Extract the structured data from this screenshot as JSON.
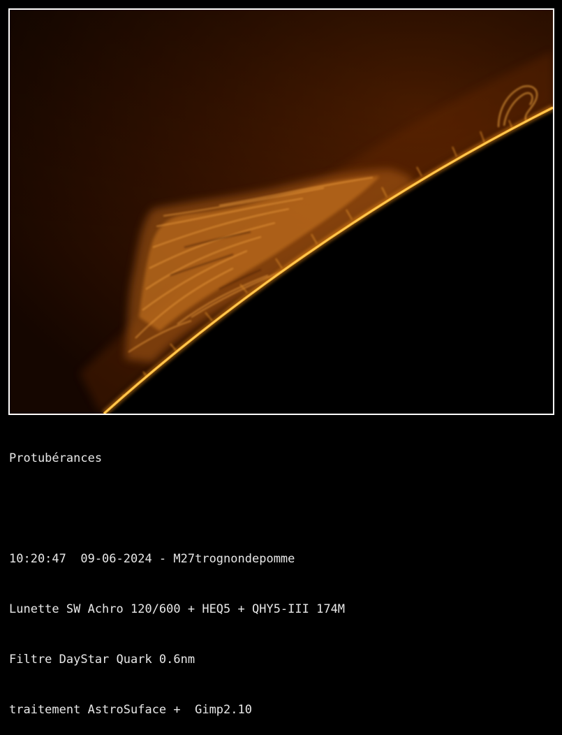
{
  "image": {
    "subject": "solar-limb-with-prominences",
    "colors": {
      "sky_dark": "#150600",
      "sky_mid": "#3a1400",
      "sky_glow": "#5a2200",
      "limb_bright": "#ffb733",
      "limb_hot": "#ffd166",
      "prominence": "#c46a14",
      "prominence_light": "#e08a28",
      "disk": "#000000",
      "frame_border": "#ffffff"
    }
  },
  "caption": {
    "title": "Protubérances",
    "time_date_author": "10:20:47  09-06-2024 - M27trognondepomme",
    "equipment": "Lunette SW Achro 120/600 + HEQ5 + QHY5-III 174M",
    "filter": "Filtre DayStar Quark 0.6nm",
    "processing": "traitement AstroSuface +  Gimp2.10"
  }
}
